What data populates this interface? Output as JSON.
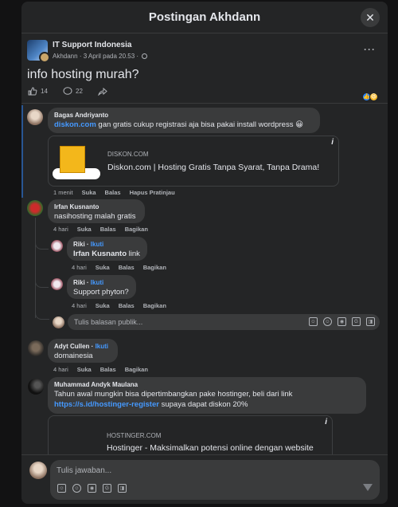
{
  "modal": {
    "title": "Postingan Akhdann",
    "close": "✕"
  },
  "post": {
    "group": "IT Support Indonesia",
    "author": "Akhdann",
    "date": "3 April pada 20.53",
    "text": "info hosting murah?",
    "likes": "14",
    "comments": "22"
  },
  "comments": [
    {
      "name": "Bagas Andriyanto",
      "link": "diskon.com",
      "text": " gan gratis cukup registrasi aja bisa pakai install wordpress 😀",
      "preview": {
        "domain": "DISKON.COM",
        "title": "Diskon.com | Hosting Gratis Tanpa Syarat, Tanpa Drama!"
      },
      "time": "1 menit",
      "a1": "Suka",
      "a2": "Balas",
      "a3": "Hapus Pratinjau"
    },
    {
      "name": "Irfan Kusnanto",
      "text": "nasihosting malah gratis",
      "time": "4 hari",
      "a1": "Suka",
      "a2": "Balas",
      "a3": "Bagikan",
      "replies": [
        {
          "name": "Riki",
          "follow": "Ikuti",
          "tag": "Irfan Kusnanto",
          "text": " link",
          "time": "4 hari",
          "a1": "Suka",
          "a2": "Balas",
          "a3": "Bagikan"
        },
        {
          "name": "Riki",
          "follow": "Ikuti",
          "text": "Support phyton?",
          "time": "4 hari",
          "a1": "Suka",
          "a2": "Balas",
          "a3": "Bagikan"
        }
      ],
      "reply_placeholder": "Tulis balasan publik..."
    },
    {
      "name": "Adyt Cullen",
      "follow": "Ikuti",
      "text": "domainesia",
      "time": "4 hari",
      "a1": "Suka",
      "a2": "Balas",
      "a3": "Bagikan"
    },
    {
      "name": "Muhammad Andyk Maulana",
      "text1": "Tahun awal mungkin bisa dipertimbangkan pake hostinger, beli dari link",
      "link": "https://s.id/hostinger-register",
      "text2": " supaya dapat diskon 20%",
      "preview": {
        "domain": "HOSTINGER.COM",
        "title": "Hostinger - Maksimalkan potensi online dengan website"
      }
    }
  ],
  "composer": {
    "placeholder": "Tulis jawaban..."
  },
  "colors": {
    "link": "#4599ff",
    "bubble": "#3a3b3c",
    "modal": "#242526"
  }
}
